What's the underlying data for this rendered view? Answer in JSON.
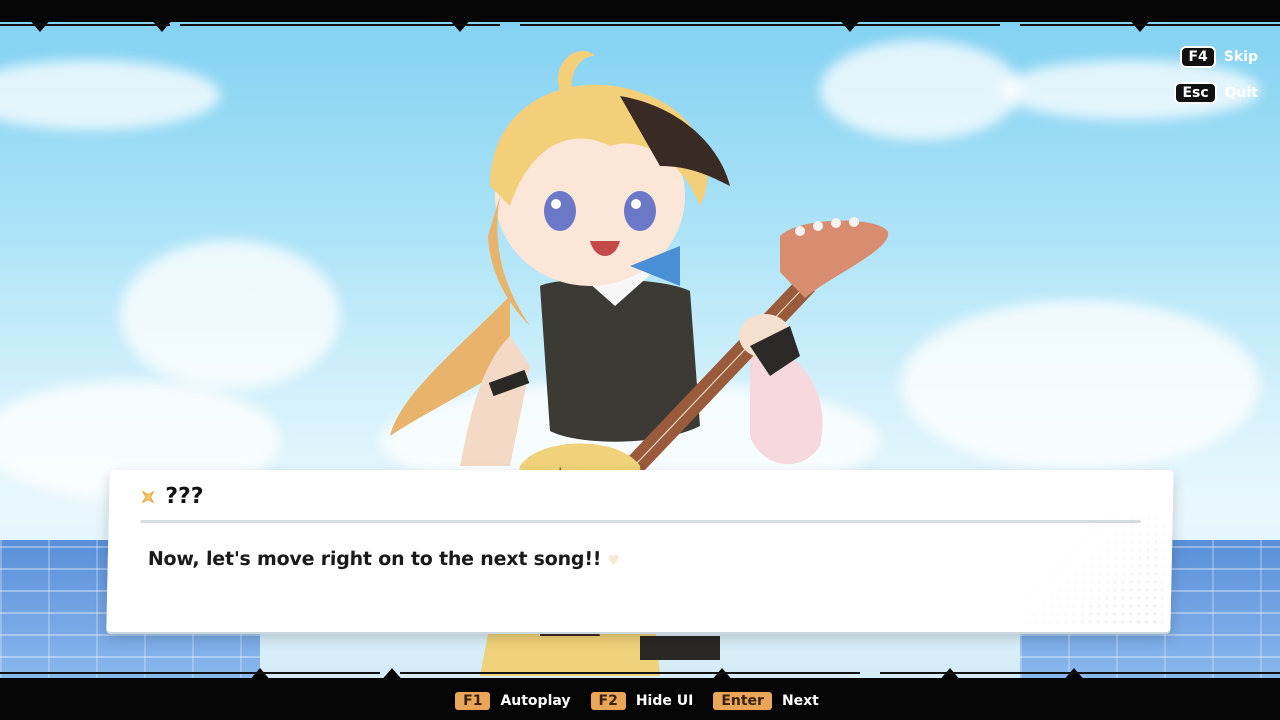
{
  "hud": {
    "skip": {
      "key": "F4",
      "label": "Skip"
    },
    "quit": {
      "key": "Esc",
      "label": "Quit"
    }
  },
  "dialogue": {
    "speaker": "???",
    "text": "Now, let's move right on to the next song!!"
  },
  "controls": [
    {
      "key": "F1",
      "label": "Autoplay"
    },
    {
      "key": "F2",
      "label": "Hide UI"
    },
    {
      "key": "Enter",
      "label": "Next"
    }
  ],
  "icons": {
    "speaker_icon": "sparkle-icon",
    "advance_indicator": "heart-icon"
  },
  "colors": {
    "key_accent": "#e9a659",
    "speaker_star": "#e39a2b",
    "hair_blonde": "#f3cf7a",
    "vest": "#3c3a34"
  }
}
